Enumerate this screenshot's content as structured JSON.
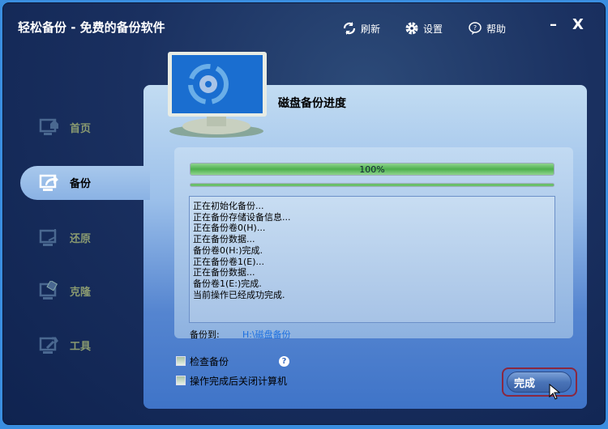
{
  "window": {
    "title": "轻松备份 - 免费的备份软件"
  },
  "toolbar": {
    "refresh": "刷新",
    "settings": "设置",
    "help": "帮助",
    "minimize": "–",
    "close": "X"
  },
  "sidebar": {
    "items": [
      {
        "label": "首页"
      },
      {
        "label": "备份",
        "active": true
      },
      {
        "label": "还原"
      },
      {
        "label": "克隆"
      },
      {
        "label": "工具"
      }
    ]
  },
  "main": {
    "title": "磁盘备份进度",
    "progress_label": "100%",
    "progress_percent": 100,
    "log": [
      "正在初始化备份...",
      "正在备份存储设备信息...",
      "正在备份卷0(H)...",
      "正在备份数据...",
      "备份卷0(H:)完成.",
      "正在备份卷1(E)...",
      "正在备份数据...",
      "备份卷1(E:)完成.",
      "当前操作已经成功完成."
    ],
    "dest_label": "备份到:",
    "dest_value": "H:\\磁盘备份",
    "check_backup": "检查备份",
    "shutdown": "操作完成后关闭计算机",
    "help_icon": "?",
    "finish": "完成"
  },
  "colors": {
    "accent": "#4eb04e",
    "link": "#1a6ee0"
  }
}
